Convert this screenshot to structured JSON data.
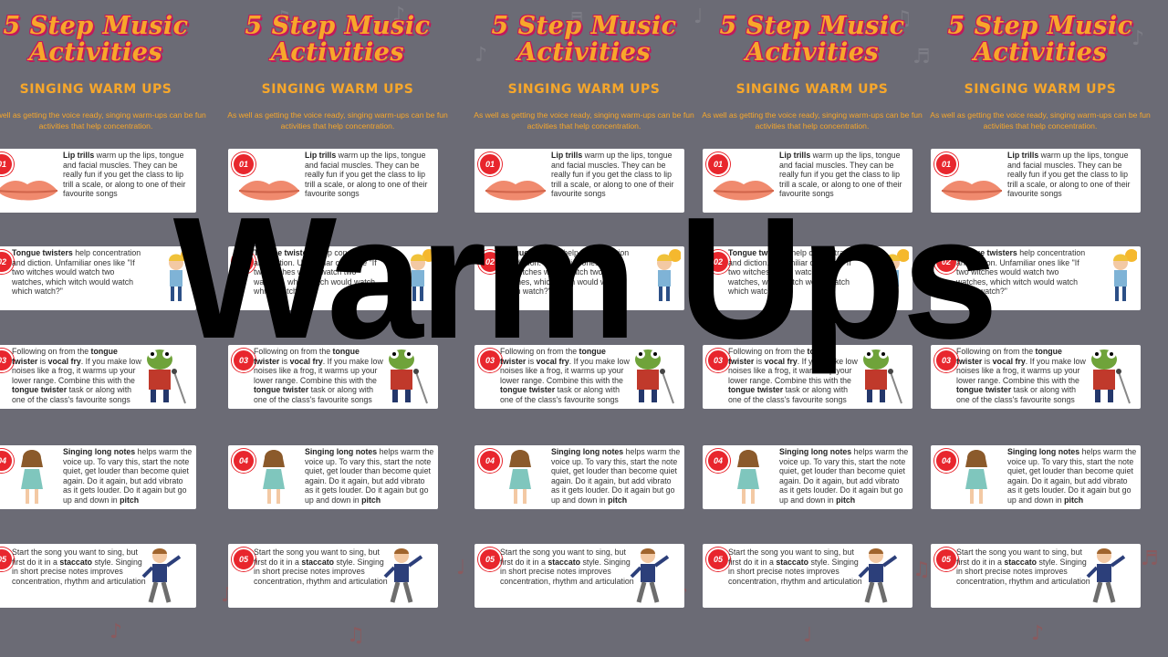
{
  "overlay_title": "Warm Ups",
  "poster": {
    "title_line1": "5 Step Music",
    "title_line2": "Activities",
    "subtitle": "SINGING WARM UPS",
    "intro": "As well as getting the voice ready, singing warm-ups can be fun activities that help concentration."
  },
  "steps": [
    {
      "num": "01",
      "bold": "Lip trills",
      "text": " warm up the lips, tongue and facial muscles. They can be really fun if you get the class to lip trill a scale, or along to one of their favourite songs",
      "image": "lips-icon"
    },
    {
      "num": "02",
      "bold": "Tongue twisters",
      "text": " help concentration and diction. Unfamiliar ones like \"If two witches would watch two watches, which witch would watch which watch?\"",
      "image": "girl-with-pompom-icon"
    },
    {
      "num": "03",
      "pre": "Following on from the ",
      "bold": "tongue twister",
      "mid": " is ",
      "bold2": "vocal fry",
      "text": ".  If you make low noises like a frog, it warms up your lower range.  Combine this with the ",
      "bold3": "tongue twister",
      "post": " task or along with one of the class's favourite songs",
      "image": "singing-frog-icon"
    },
    {
      "num": "04",
      "bold": "Singing long notes",
      "text": " helps warm the voice up.  To vary this, start the note quiet, get louder than become quiet again.  Do it again, but add vibrato as it gets louder.  Do it again but go up and down in ",
      "bold2": "pitch",
      "image": "singing-girl-icon"
    },
    {
      "num": "05",
      "pre": "Start the song you want to sing, but first do it in a ",
      "bold": "staccato",
      "text": " style.  Singing in short precise notes improves concentration, rhythm and articulation",
      "image": "dancing-boy-icon"
    }
  ],
  "colors": {
    "background": "#6b6b75",
    "title": "#f7a72b",
    "title_outline": "#c2185b",
    "badge": "#e8262d",
    "overlay_text": "#000000"
  }
}
